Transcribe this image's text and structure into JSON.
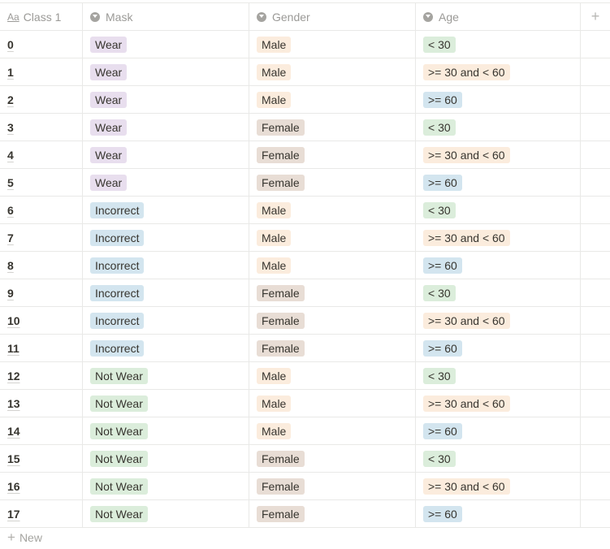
{
  "headers": {
    "title_icon": "Aa",
    "title": "Class 1",
    "mask": "Mask",
    "gender": "Gender",
    "age": "Age",
    "add_column": "+"
  },
  "colors": {
    "Wear": "#e8deee",
    "Incorrect": "#d3e5ef",
    "Not Wear": "#dbeddb",
    "Male": "#fbecdd",
    "Female": "#e8ddd5",
    "< 30": "#dbeddb",
    ">= 30 and < 60": "#fbecdd",
    ">= 60": "#d3e5ef"
  },
  "rows": [
    {
      "class": "0",
      "mask": "Wear",
      "gender": "Male",
      "age": "< 30"
    },
    {
      "class": "1",
      "mask": "Wear",
      "gender": "Male",
      "age": ">= 30 and < 60"
    },
    {
      "class": "2",
      "mask": "Wear",
      "gender": "Male",
      "age": ">= 60"
    },
    {
      "class": "3",
      "mask": "Wear",
      "gender": "Female",
      "age": "< 30"
    },
    {
      "class": "4",
      "mask": "Wear",
      "gender": "Female",
      "age": ">= 30 and < 60"
    },
    {
      "class": "5",
      "mask": "Wear",
      "gender": "Female",
      "age": ">= 60"
    },
    {
      "class": "6",
      "mask": "Incorrect",
      "gender": "Male",
      "age": "< 30"
    },
    {
      "class": "7",
      "mask": "Incorrect",
      "gender": "Male",
      "age": ">= 30 and < 60"
    },
    {
      "class": "8",
      "mask": "Incorrect",
      "gender": "Male",
      "age": ">= 60"
    },
    {
      "class": "9",
      "mask": "Incorrect",
      "gender": "Female",
      "age": "< 30"
    },
    {
      "class": "10",
      "mask": "Incorrect",
      "gender": "Female",
      "age": ">= 30 and < 60"
    },
    {
      "class": "11",
      "mask": "Incorrect",
      "gender": "Female",
      "age": ">= 60"
    },
    {
      "class": "12",
      "mask": "Not Wear",
      "gender": "Male",
      "age": "< 30"
    },
    {
      "class": "13",
      "mask": "Not Wear",
      "gender": "Male",
      "age": ">= 30 and < 60"
    },
    {
      "class": "14",
      "mask": "Not Wear",
      "gender": "Male",
      "age": ">= 60"
    },
    {
      "class": "15",
      "mask": "Not Wear",
      "gender": "Female",
      "age": "< 30"
    },
    {
      "class": "16",
      "mask": "Not Wear",
      "gender": "Female",
      "age": ">= 30 and < 60"
    },
    {
      "class": "17",
      "mask": "Not Wear",
      "gender": "Female",
      "age": ">= 60"
    }
  ],
  "footer": {
    "new_label": "New",
    "new_icon": "+"
  }
}
